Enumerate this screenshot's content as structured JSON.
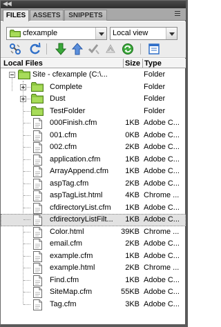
{
  "tabs": [
    {
      "label": "FILES",
      "active": true
    },
    {
      "label": "ASSETS",
      "active": false
    },
    {
      "label": "SNIPPETS",
      "active": false
    }
  ],
  "site_select": {
    "value": "cfexample"
  },
  "view_select": {
    "value": "Local view"
  },
  "toolbar": {
    "icons": [
      "connect-icon",
      "refresh-icon",
      "get-files-icon",
      "put-files-icon",
      "check-out-icon",
      "check-in-icon",
      "synchronize-icon",
      "expand-panel-icon"
    ]
  },
  "columns": {
    "name": "Local Files",
    "size": "Size",
    "type": "Type"
  },
  "root": {
    "label": "Site - cfexample (C:\\...",
    "type": "Folder"
  },
  "folders": [
    {
      "label": "Complete",
      "type": "Folder",
      "expander": "plus"
    },
    {
      "label": "Dust",
      "type": "Folder",
      "expander": "plus"
    },
    {
      "label": "TestFolder",
      "type": "Folder",
      "expander": "none"
    }
  ],
  "files": [
    {
      "name": "000Finish.cfm",
      "size": "1KB",
      "type": "Adobe C..."
    },
    {
      "name": "001.cfm",
      "size": "0KB",
      "type": "Adobe C..."
    },
    {
      "name": "002.cfm",
      "size": "2KB",
      "type": "Adobe C..."
    },
    {
      "name": "application.cfm",
      "size": "1KB",
      "type": "Adobe C..."
    },
    {
      "name": "ArrayAppend.cfm",
      "size": "1KB",
      "type": "Adobe C..."
    },
    {
      "name": "aspTag.cfm",
      "size": "2KB",
      "type": "Adobe C..."
    },
    {
      "name": "aspTagList.html",
      "size": "4KB",
      "type": "Chrome ..."
    },
    {
      "name": "cfdirectoryList.cfm",
      "size": "1KB",
      "type": "Adobe C..."
    },
    {
      "name": "cfdirectoryListFilt...",
      "size": "1KB",
      "type": "Adobe C...",
      "selected": true
    },
    {
      "name": "Color.html",
      "size": "39KB",
      "type": "Chrome ..."
    },
    {
      "name": "email.cfm",
      "size": "2KB",
      "type": "Adobe C..."
    },
    {
      "name": "example.cfm",
      "size": "1KB",
      "type": "Adobe C..."
    },
    {
      "name": "example.html",
      "size": "2KB",
      "type": "Chrome ..."
    },
    {
      "name": "Find.cfm",
      "size": "1KB",
      "type": "Adobe C..."
    },
    {
      "name": "SiteMap.cfm",
      "size": "55KB",
      "type": "Adobe C..."
    },
    {
      "name": "Tag.cfm",
      "size": "3KB",
      "type": "Adobe C..."
    }
  ],
  "colors": {
    "folder": "#8cc63f",
    "selected_row": "#e2e2e2",
    "toolbar_green": "#3aa83a",
    "toolbar_blue": "#2f6fc8"
  }
}
